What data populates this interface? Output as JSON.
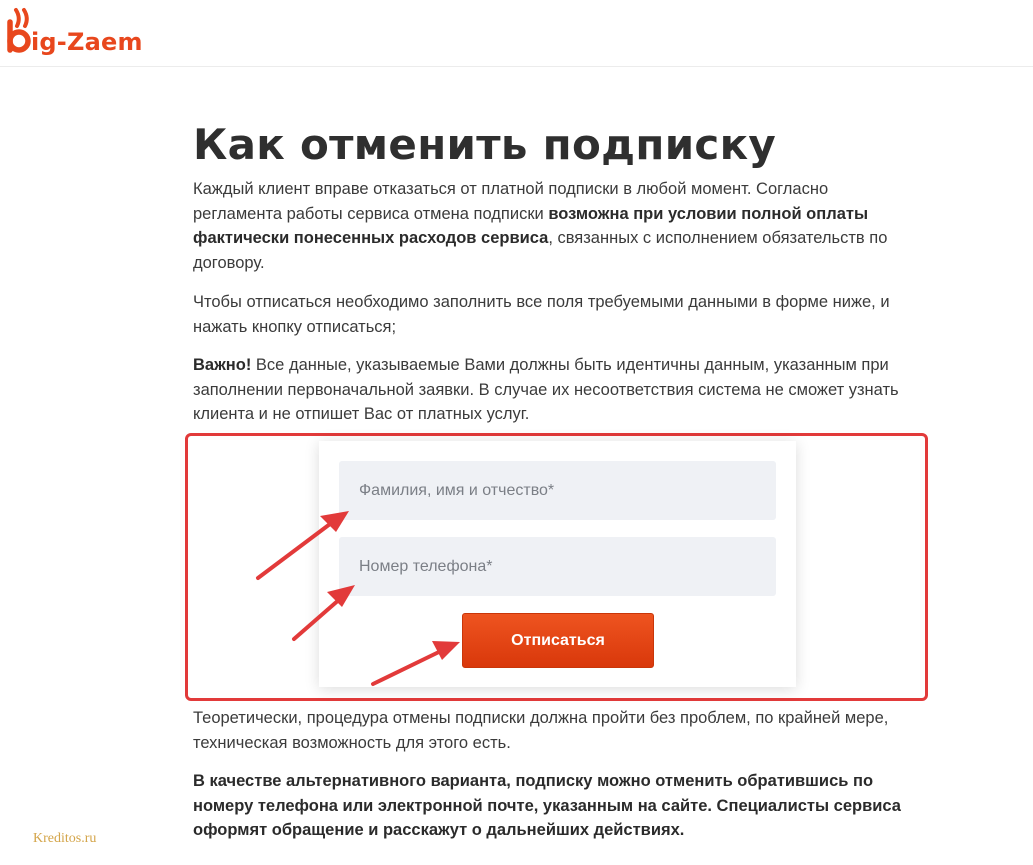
{
  "header": {
    "logo_text": "ig-Zaem",
    "logo_color": "#e8471d"
  },
  "article": {
    "title": "Как отменить подписку",
    "p1": {
      "a": "Каждый клиент вправе отказаться от платной подписки в любой момент. Согласно регламента работы сервиса отмена подписки ",
      "bold": "возможна при условии полной оплаты фактически понесенных расходов сервиса",
      "b": ", связанных с исполнением обязательств по договору."
    },
    "p2": "Чтобы отписаться необходимо заполнить все поля требуемыми данными в форме ниже, и нажать кнопку отписаться;",
    "p3": {
      "bold": "Важно!",
      "text": " Все данные, указываемые Вами должны быть идентичны данным, указанным при заполнении первоначальной заявки. В случае их несоответствия система не сможет узнать клиента и не отпишет Вас от платных услуг."
    },
    "p4": "Теоретически, процедура отмены подписки должна пройти без проблем, по крайней мере, техническая возможность для этого есть.",
    "p5": "В качестве альтернативного варианта, подписку можно отменить обратившись по номеру телефона или электронной почте, указанным на сайте. Специалисты сервиса оформят обращение и расскажут о дальнейших действиях."
  },
  "form": {
    "fio_placeholder": "Фамилия, имя и отчество*",
    "phone_placeholder": "Номер телефона*",
    "submit_label": "Отписаться"
  },
  "annotations": {
    "highlight_color": "#e23a3a",
    "arrow_color": "#e23a3a"
  },
  "watermark": "Kreditos.ru"
}
